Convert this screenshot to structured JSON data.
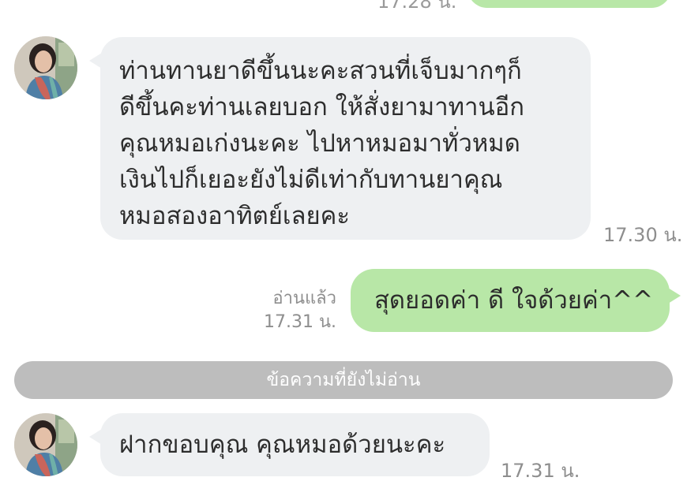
{
  "chat": {
    "top_clipped": {
      "time": "17.28 น."
    },
    "messages": [
      {
        "lines": [
          "ท่านทานยาดีขึ้นนะคะสวนที่เจ็บมากๆก็",
          "ดีขึ้นคะท่านเลยบอก ให้สั่งยามาทานอีก",
          "คุณหมอเก่งนะคะ ไปหาหมอมาทั่วหมด",
          "เงินไปก็เยอะยังไม่ดีเท่ากับทานยาคุณ",
          "หมอสองอาทิตย์เลยคะ"
        ],
        "time": "17.30 น."
      },
      {
        "text": "สุดยอดค่า ดี ใจด้วยค่า^^",
        "read_label": "อ่านแล้ว",
        "time": "17.31 น."
      },
      {
        "text": "ฝากขอบคุณ คุณหมอด้วยนะคะ",
        "time": "17.31 น."
      }
    ],
    "unread_divider": "ข้อความที่ยังไม่อ่าน"
  },
  "colors": {
    "outgoing_bubble": "#b8e7a7",
    "incoming_bubble": "#eef0f2",
    "divider": "#bdbdbd",
    "timestamp": "#8e8e8e"
  },
  "icons": {
    "avatar": "profile-photo"
  }
}
